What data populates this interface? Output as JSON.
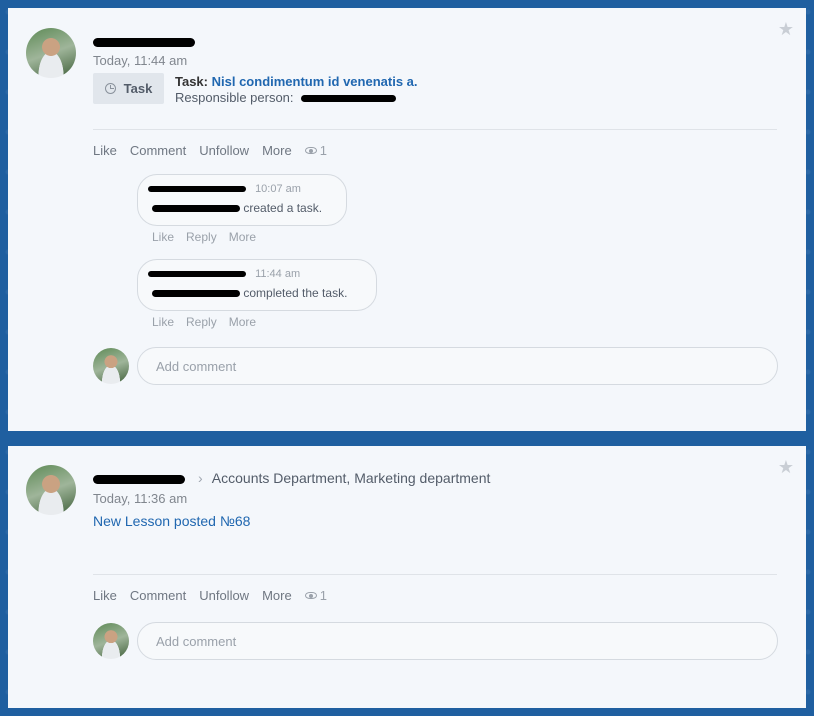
{
  "posts": [
    {
      "timestamp": "Today, 11:44 am",
      "task": {
        "badge_label": "Task",
        "title_prefix": "Task:",
        "title": "Nisl condimentum id venenatis a.",
        "responsible_label": "Responsible person:"
      },
      "actions": {
        "like": "Like",
        "comment": "Comment",
        "unfollow": "Unfollow",
        "more": "More",
        "views": "1"
      },
      "comments": [
        {
          "time": "10:07 am",
          "text": "created a task.",
          "actions": {
            "like": "Like",
            "reply": "Reply",
            "more": "More"
          }
        },
        {
          "time": "11:44 am",
          "text": "completed the task.",
          "actions": {
            "like": "Like",
            "reply": "Reply",
            "more": "More"
          }
        }
      ],
      "comment_placeholder": "Add comment"
    },
    {
      "timestamp": "Today, 11:36 am",
      "destination": "Accounts Department, Marketing department",
      "content_link": "New Lesson posted №68",
      "actions": {
        "like": "Like",
        "comment": "Comment",
        "unfollow": "Unfollow",
        "more": "More",
        "views": "1"
      },
      "comment_placeholder": "Add comment"
    }
  ],
  "icons": {
    "star": "star-icon",
    "task": "clock-icon",
    "views": "eye-icon",
    "chevron": "chevron-right-icon"
  },
  "colors": {
    "background": "#1f5fa0",
    "card": "#f4f7fb",
    "link": "#2067b0",
    "redaction": "#000000"
  }
}
